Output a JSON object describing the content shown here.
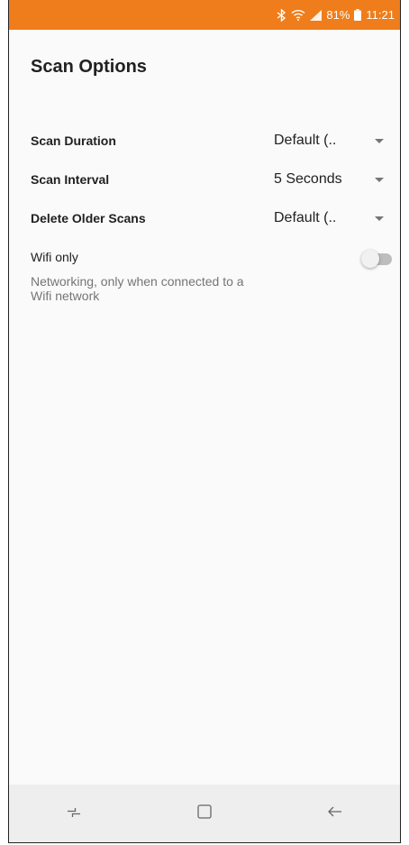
{
  "status_bar": {
    "battery": "81%",
    "time": "11:21",
    "icons": [
      "bluetooth-icon",
      "wifi-icon",
      "signal-icon",
      "battery-icon"
    ],
    "background": "#ef7d1b"
  },
  "page": {
    "title": "Scan Options"
  },
  "settings": [
    {
      "label": "Scan Duration",
      "value": "Default (.."
    },
    {
      "label": "Scan Interval",
      "value": "5 Seconds"
    },
    {
      "label": "Delete Older Scans",
      "value": "Default (.."
    }
  ],
  "wifi": {
    "title": "Wifi only",
    "description": "Networking, only when connected to a Wifi network",
    "enabled": false
  },
  "nav_bar": {
    "icons": [
      "recents-icon",
      "home-icon",
      "back-icon"
    ]
  }
}
